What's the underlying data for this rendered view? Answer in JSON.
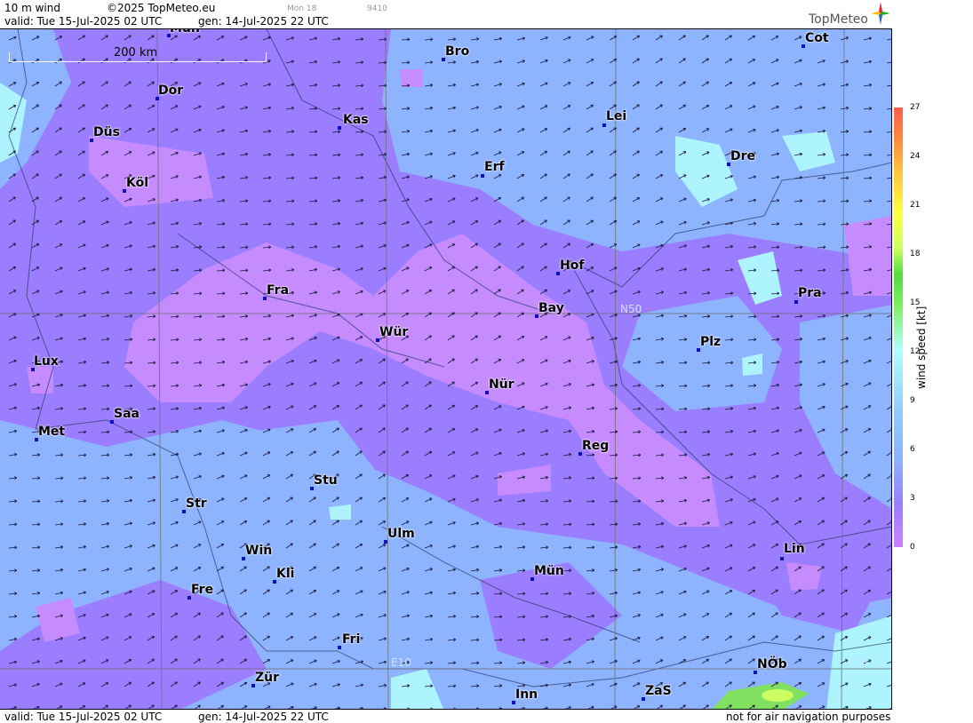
{
  "header": {
    "product": "10 m wind",
    "copyright": "©2025 TopMeteo.eu",
    "day": "Mon 18",
    "code": "9410",
    "valid": "valid:  Tue  15-Jul-2025  02 UTC",
    "gen": "gen: 14-Jul-2025 22 UTC",
    "logo": "TopMeteo"
  },
  "footer": {
    "valid": "valid:  Tue  15-Jul-2025  02 UTC",
    "gen": "gen: 14-Jul-2025 22 UTC",
    "notice": "not for air navigation purposes"
  },
  "scale": {
    "label": "200 km"
  },
  "grid_labels": {
    "n50": "N50",
    "e10": "E10",
    "e15": "E15"
  },
  "legend": {
    "title": "wind  speed  [kt]",
    "ticks": [
      "27",
      "24",
      "21",
      "18",
      "15",
      "12",
      "9",
      "6",
      "3",
      "0"
    ]
  },
  "cities": [
    {
      "name": "Mün",
      "id": "muenster"
    },
    {
      "name": "Bro",
      "id": "bro"
    },
    {
      "name": "Cot",
      "id": "cot"
    },
    {
      "name": "Dor",
      "id": "dor"
    },
    {
      "name": "Kas",
      "id": "kas"
    },
    {
      "name": "Lei",
      "id": "lei"
    },
    {
      "name": "Düs",
      "id": "dues"
    },
    {
      "name": "Erf",
      "id": "erf"
    },
    {
      "name": "Dre",
      "id": "dre"
    },
    {
      "name": "Köl",
      "id": "koel"
    },
    {
      "name": "Hof",
      "id": "hof"
    },
    {
      "name": "Fra",
      "id": "fra"
    },
    {
      "name": "Bay",
      "id": "bay"
    },
    {
      "name": "Pra",
      "id": "pra"
    },
    {
      "name": "Wür",
      "id": "wuer"
    },
    {
      "name": "Plz",
      "id": "plz"
    },
    {
      "name": "Lux",
      "id": "lux"
    },
    {
      "name": "Nür",
      "id": "nuer"
    },
    {
      "name": "Saa",
      "id": "saa"
    },
    {
      "name": "Met",
      "id": "met"
    },
    {
      "name": "Reg",
      "id": "reg"
    },
    {
      "name": "Stu",
      "id": "stu"
    },
    {
      "name": "Str",
      "id": "str"
    },
    {
      "name": "Ulm",
      "id": "ulm"
    },
    {
      "name": "Win",
      "id": "win"
    },
    {
      "name": "Lin",
      "id": "lin"
    },
    {
      "name": "Kli",
      "id": "kli"
    },
    {
      "name": "Mün",
      "id": "muenchen"
    },
    {
      "name": "Fre",
      "id": "fre"
    },
    {
      "name": "Fri",
      "id": "fri"
    },
    {
      "name": "NÖb",
      "id": "noeb"
    },
    {
      "name": "Zür",
      "id": "zuer"
    },
    {
      "name": "Inn",
      "id": "inn"
    },
    {
      "name": "ZaS",
      "id": "zas"
    }
  ],
  "colors": {
    "calm": "#c68cff",
    "light": "#9b7dff",
    "moderate": "#8fb4ff",
    "fresh": "#aef4ff",
    "strong": "#80e060"
  }
}
